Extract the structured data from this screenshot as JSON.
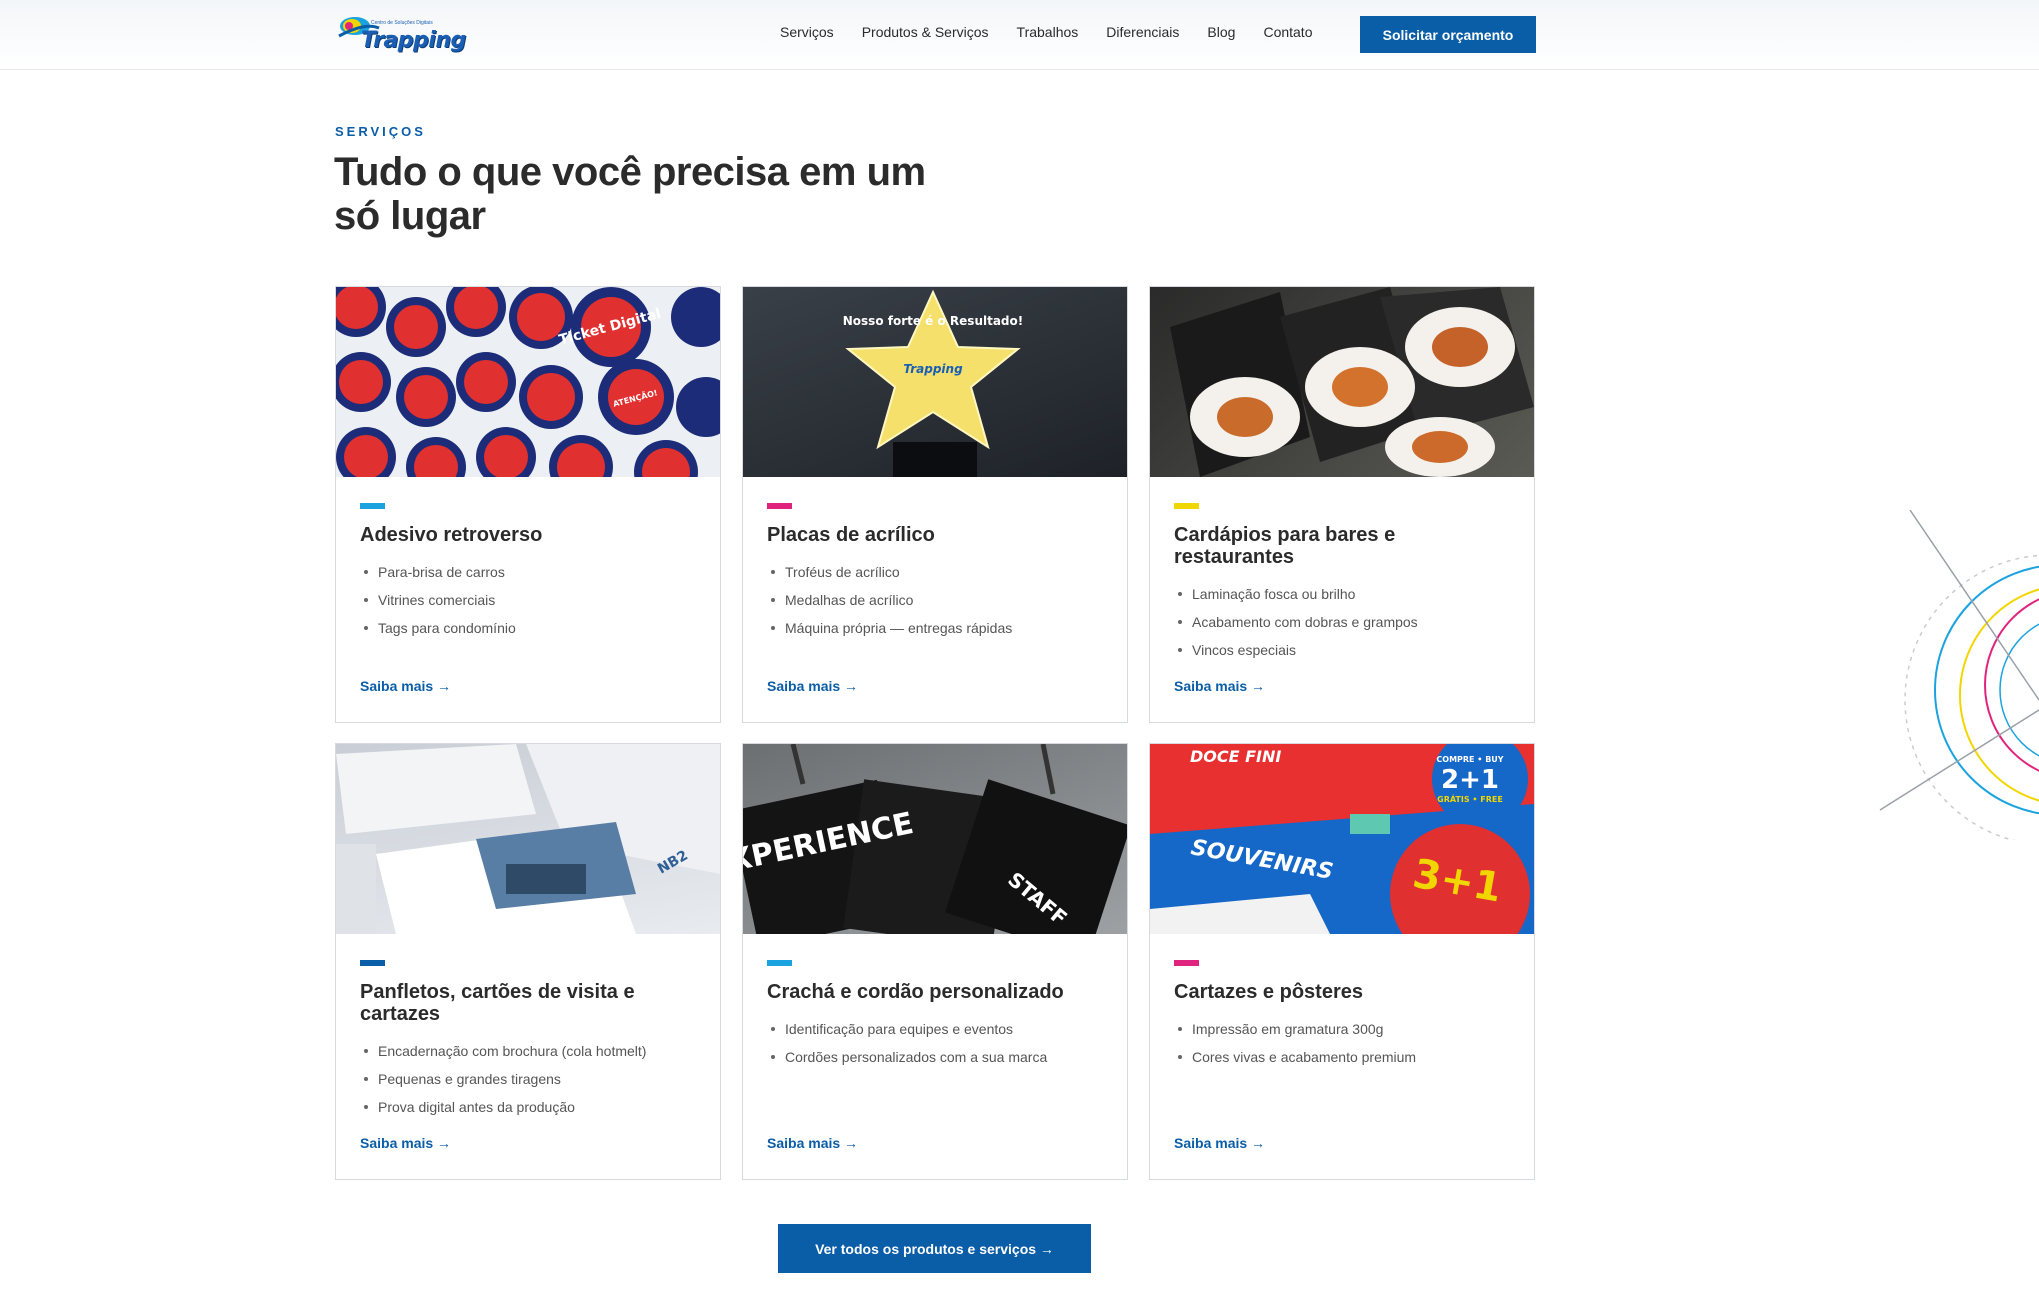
{
  "header": {
    "logo_text": "Trapping",
    "logo_tagline": "Centro de Soluções Digitais",
    "nav": [
      "Serviços",
      "Produtos & Serviços",
      "Trabalhos",
      "Diferenciais",
      "Blog",
      "Contato"
    ],
    "cta": "Solicitar orçamento"
  },
  "section": {
    "eyebrow": "SERVIÇOS",
    "title": "Tudo o que você precisa em um só lugar"
  },
  "cards": [
    {
      "title": "Adesivo retroverso",
      "accent": "#1ba3e0",
      "items": [
        "Para-brisa de carros",
        "Vitrines comerciais",
        "Tags para condomínio"
      ],
      "link": "Saiba mais →",
      "image_texts": [
        "Ticket Digital",
        "ATENÇÃO!"
      ]
    },
    {
      "title": "Placas de acrílico",
      "accent": "#e0247d",
      "items": [
        "Troféus de acrílico",
        "Medalhas de acrílico",
        "Máquina própria — entregas rápidas"
      ],
      "link": "Saiba mais →",
      "image_texts": [
        "Nosso forte é o Resultado!",
        "Trapping"
      ]
    },
    {
      "title": "Cardápios para bares e restaurantes",
      "accent": "#f2d600",
      "items": [
        "Laminação fosca ou brilho",
        "Acabamento com dobras e grampos",
        "Vincos especiais"
      ],
      "link": "Saiba mais →"
    },
    {
      "title": "Panfletos, cartões de visita e cartazes",
      "accent": "#0a5da7",
      "items": [
        "Encadernação com brochura (cola hotmelt)",
        "Pequenas e grandes tiragens",
        "Prova digital antes da produção"
      ],
      "link": "Saiba mais →",
      "image_texts": [
        "NB2"
      ]
    },
    {
      "title": "Crachá e cordão personalizado",
      "accent": "#1ba3e0",
      "items": [
        "Identificação para equipes e eventos",
        "Cordões personalizados com a sua marca"
      ],
      "link": "Saiba mais →",
      "image_texts": [
        "EXPERIENCE",
        "STAFF"
      ]
    },
    {
      "title": "Cartazes e pôsteres",
      "accent": "#e0247d",
      "items": [
        "Impressão em gramatura 300g",
        "Cores vivas e acabamento premium"
      ],
      "link": "Saiba mais →",
      "image_texts": [
        "DOCE FINI",
        "COMPRE • BUY",
        "2+1",
        "GRÁTIS • FREE",
        "SOUVENIRS",
        "3+1"
      ]
    }
  ],
  "footer_cta": "Ver todos os produtos e serviços →",
  "colors": {
    "primary": "#0a5da7",
    "cyan": "#1ba3e0",
    "magenta": "#e0247d",
    "yellow": "#f2d600",
    "text": "#2b2b2b"
  }
}
